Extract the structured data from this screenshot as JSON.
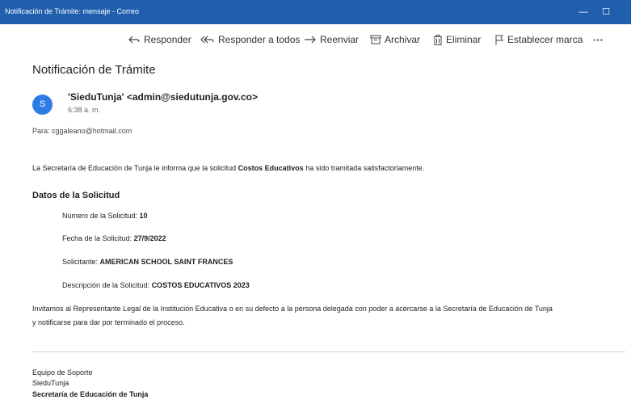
{
  "window": {
    "title": "Notificación de Trámite: mensaje - Correo",
    "minimize_glyph": "—",
    "maximize_glyph": "☐"
  },
  "toolbar": {
    "reply": "Responder",
    "reply_all": "Responder a todos",
    "forward": "Reenviar",
    "archive": "Archivar",
    "delete": "Eliminar",
    "flag": "Establecer marca",
    "more": "···"
  },
  "email": {
    "subject": "Notificación de Trámite",
    "avatar_letter": "S",
    "sender": "'SieduTunja' <admin@siedutunja.gov.co>",
    "time": "6:38 a. m.",
    "to_label": "Para:",
    "to_address": "cggaleano@hotmail.com"
  },
  "body": {
    "intro_before": "La Secretaría de Educación de Tunja le informa que la solicitud ",
    "intro_bold": "Costos Educativos",
    "intro_after": " ha sido tramitada satisfactoriamente.",
    "section_title": "Datos de la Solicitud",
    "number_label": "Número de la Solicitud: ",
    "number_value": "10",
    "date_label": "Fecha de la Solicitud: ",
    "date_value": "27/9/2022",
    "applicant_label": "Solicitante: ",
    "applicant_value": "AMERICAN SCHOOL SAINT FRANCES",
    "description_label": "Descripción de la Solicitud: ",
    "description_value": "COSTOS EDUCATIVOS 2023",
    "closing_line1": "Invitamos al Representante Legal de la Institución Educativa o en su defecto a la persona delegada con poder a acercarse a la Secretaría de Educación de Tunja",
    "closing_line2": "y notificarse para dar por terminado el proceso."
  },
  "signature": {
    "line1": "Equipo de Soporte",
    "line2": "SieduTunja",
    "line3": "Secretaría de Educación de Tunja"
  },
  "colors": {
    "titlebar": "#1f5fae",
    "avatar": "#2f7be6",
    "divider": "#c8d6e6"
  }
}
